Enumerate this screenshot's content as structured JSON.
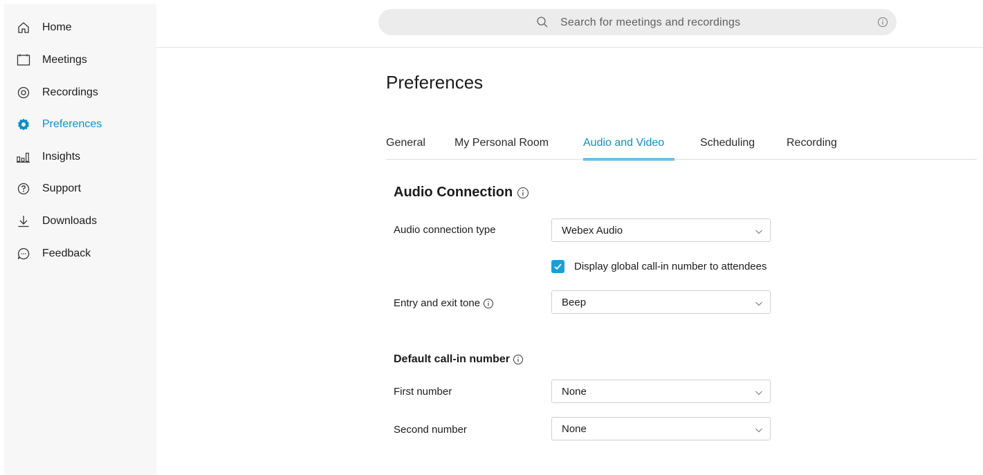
{
  "sidebar": {
    "items": [
      {
        "label": "Home",
        "icon": "home-icon"
      },
      {
        "label": "Meetings",
        "icon": "calendar-icon"
      },
      {
        "label": "Recordings",
        "icon": "recording-icon"
      },
      {
        "label": "Preferences",
        "icon": "gear-icon",
        "active": true
      },
      {
        "label": "Insights",
        "icon": "bar-chart-icon"
      },
      {
        "label": "Support",
        "icon": "help-icon"
      },
      {
        "label": "Downloads",
        "icon": "download-icon"
      },
      {
        "label": "Feedback",
        "icon": "chat-bubble-icon"
      }
    ]
  },
  "search": {
    "placeholder": "Search for meetings and recordings"
  },
  "page": {
    "title": "Preferences"
  },
  "tabs": [
    {
      "label": "General"
    },
    {
      "label": "My Personal Room"
    },
    {
      "label": "Audio and Video",
      "active": true
    },
    {
      "label": "Scheduling"
    },
    {
      "label": "Recording"
    }
  ],
  "audio": {
    "section_title": "Audio Connection",
    "connection_type_label": "Audio connection type",
    "connection_type_value": "Webex Audio",
    "global_callin_label": "Display global call-in number to attendees",
    "global_callin_checked": true,
    "tone_label": "Entry and exit tone",
    "tone_value": "Beep"
  },
  "callin": {
    "section_title": "Default call-in number",
    "first_label": "First number",
    "first_value": "None",
    "second_label": "Second number",
    "second_value": "None"
  },
  "colors": {
    "accent": "#0f8ec5",
    "checkbox": "#1a9fd6",
    "sidebar_bg": "#f7f7f7"
  }
}
